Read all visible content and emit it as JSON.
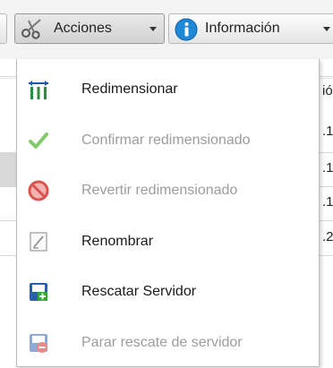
{
  "toolbar": {
    "acciones_label": "Acciones",
    "informacion_label": "Información"
  },
  "grid": {
    "right_cells": [
      "ió",
      ".1",
      ".1",
      ".1",
      ".2"
    ]
  },
  "menu": {
    "items": [
      {
        "label": "Redimensionar",
        "icon": "resize-icon",
        "enabled": true
      },
      {
        "label": "Confirmar redimensionado",
        "icon": "checkmark-icon",
        "enabled": false
      },
      {
        "label": "Revertir redimensionado",
        "icon": "no-entry-icon",
        "enabled": false
      },
      {
        "label": "Renombrar",
        "icon": "rename-icon",
        "enabled": true
      },
      {
        "label": "Rescatar Servidor",
        "icon": "rescue-server-icon",
        "enabled": true
      },
      {
        "label": "Parar rescate de servidor",
        "icon": "stop-rescue-icon",
        "enabled": false
      }
    ]
  },
  "colors": {
    "info_blue": "#1e88d6",
    "check_green": "#7fc96a",
    "forbidden_red": "#d9534f",
    "rescue_green": "#2eaa2e",
    "rescue_blue": "#2a5fb0"
  }
}
